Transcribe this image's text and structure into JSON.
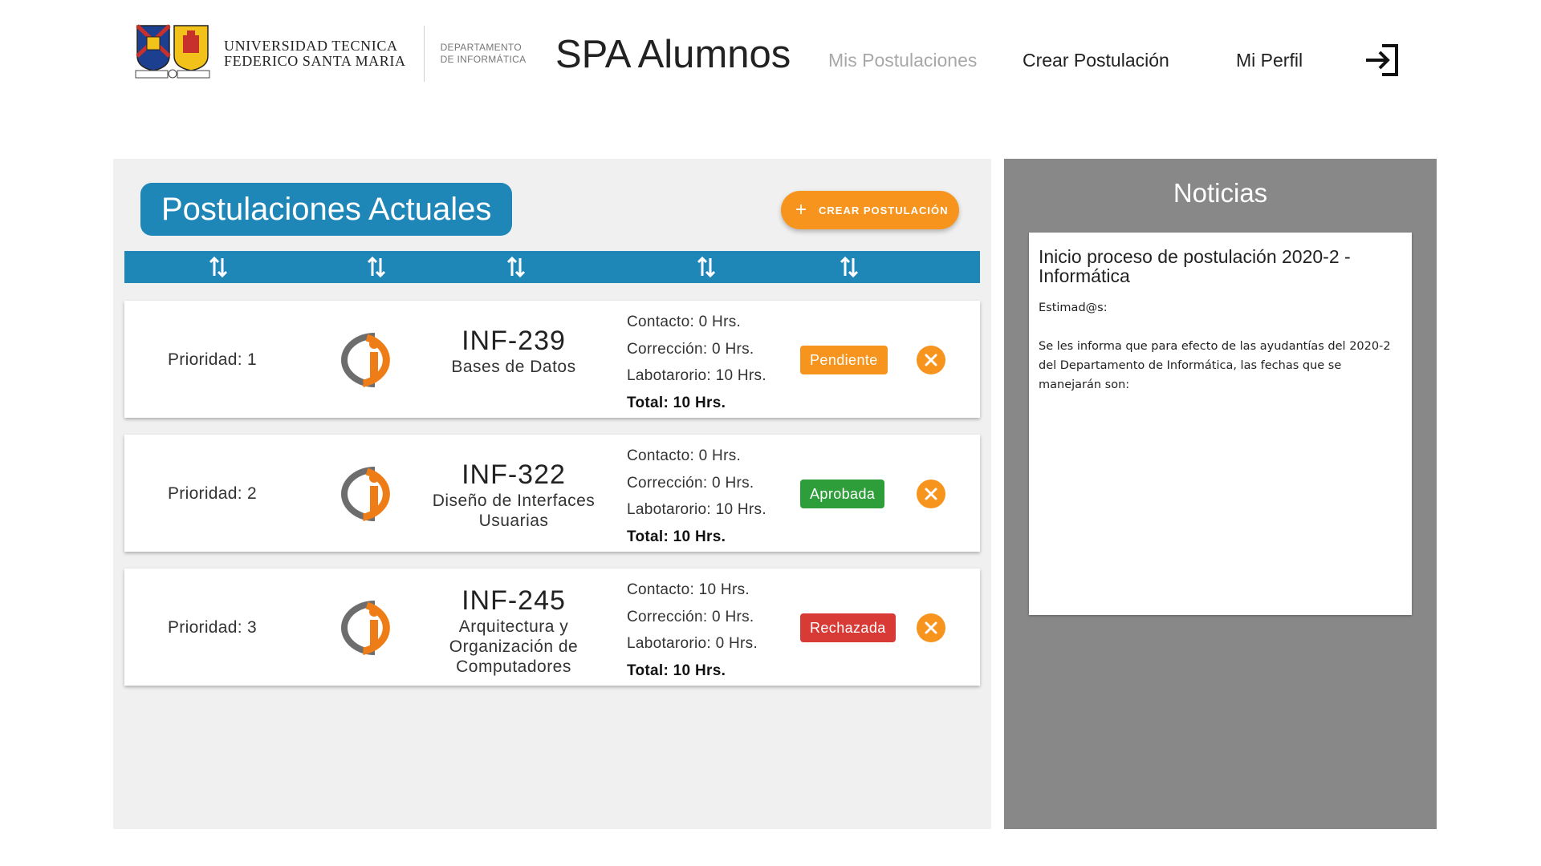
{
  "header": {
    "university_line1": "UNIVERSIDAD TECNICA",
    "university_line2": "FEDERICO SANTA MARIA",
    "crest_motto_left": "EX UMBRA",
    "crest_motto_right": "SOLEM",
    "department_line1": "DEPARTAMENTO",
    "department_line2": "DE INFORMÁTICA",
    "app_title": "SPA Alumnos",
    "nav": {
      "mis_postulaciones": "Mis Postulaciones",
      "crear_postulacion": "Crear Postulación",
      "mi_perfil": "Mi Perfil"
    },
    "logout_icon": "logout-icon",
    "active_nav": "Mis Postulaciones"
  },
  "main": {
    "title": "Postulaciones Actuales",
    "create_button_label": "CREAR POSTULACIÓN",
    "sort_icon": "sort-arrows-icon",
    "applications": [
      {
        "priority": "Prioridad: 1",
        "code": "INF-239",
        "name": "Bases de Datos",
        "contacto": "Contacto: 0 Hrs.",
        "correccion": "Corrección: 0 Hrs.",
        "laboratorio": "Labotarorio: 10 Hrs.",
        "total": "Total: 10 Hrs.",
        "status": "Pendiente",
        "status_color": "#f7941d"
      },
      {
        "priority": "Prioridad: 2",
        "code": "INF-322",
        "name": "Diseño de Interfaces Usuarias",
        "contacto": "Contacto: 0 Hrs.",
        "correccion": "Corrección: 0 Hrs.",
        "laboratorio": "Labotarorio: 10 Hrs.",
        "total": "Total: 10 Hrs.",
        "status": "Aprobada",
        "status_color": "#2e9e3a"
      },
      {
        "priority": "Prioridad: 3",
        "code": "INF-245",
        "name": "Arquitectura y Organización de Computadores",
        "contacto": "Contacto: 10 Hrs.",
        "correccion": "Corrección: 0 Hrs.",
        "laboratorio": "Labotarorio: 0 Hrs.",
        "total": "Total: 10 Hrs.",
        "status": "Rechazada",
        "status_color": "#d83a35"
      }
    ]
  },
  "news": {
    "title": "Noticias",
    "headline": "Inicio proceso de postulación 2020-2 - Informática",
    "greeting": "Estimad@s:",
    "body": "Se les informa que para efecto de las ayudantías del 2020-2 del Departamento de Informática, las fechas que se manejarán son:"
  },
  "colors": {
    "primary_blue": "#1f86b8",
    "accent_orange": "#f7941d",
    "news_gray": "#888888",
    "panel_bg": "#f0f0f0"
  }
}
